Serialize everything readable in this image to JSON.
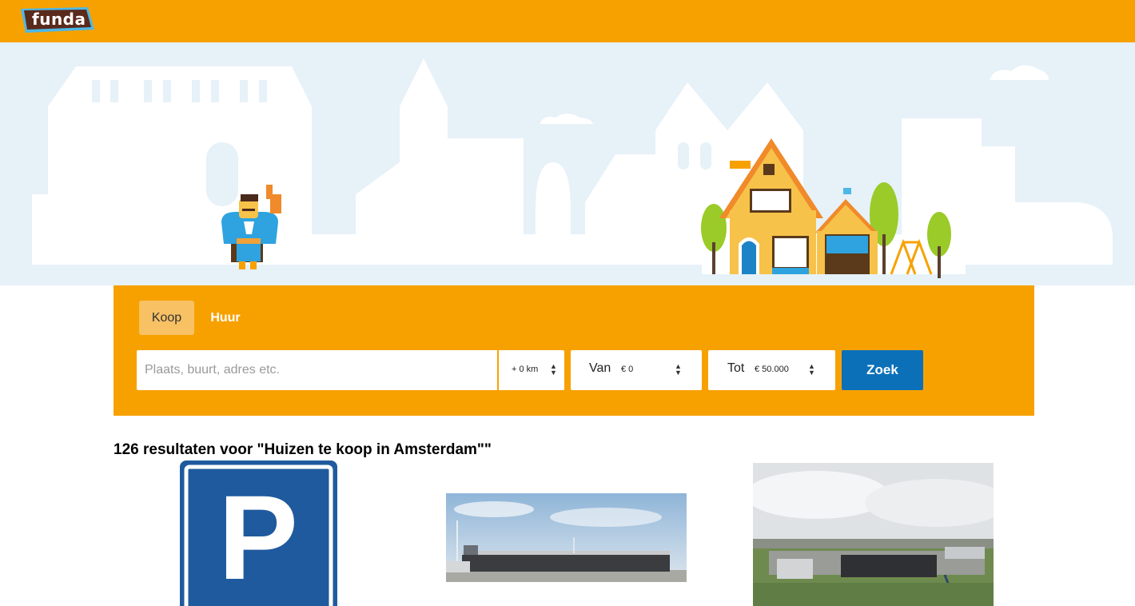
{
  "brand": {
    "logo_text": "funda",
    "orange": "#f7a100",
    "sky": "#e6f1f8",
    "blue": "#0b70b8"
  },
  "search": {
    "tabs": [
      {
        "label": "Koop",
        "active": true
      },
      {
        "label": "Huur",
        "active": false
      }
    ],
    "location_placeholder": "Plaats, buurt, adres etc.",
    "radius_value": "+ 0 km",
    "price_from_label": "Van",
    "price_from_value": "€ 0",
    "price_to_label": "Tot",
    "price_to_value": "€ 50.000",
    "submit_label": "Zoek"
  },
  "results": {
    "heading": "126 resultaten voor \"Huizen te koop in Amsterdam\"\"",
    "items": [
      {
        "image": "parking-sign-photo",
        "letter": "P"
      },
      {
        "image": "industrial-building-photo"
      },
      {
        "image": "aerial-business-park-photo"
      }
    ]
  }
}
